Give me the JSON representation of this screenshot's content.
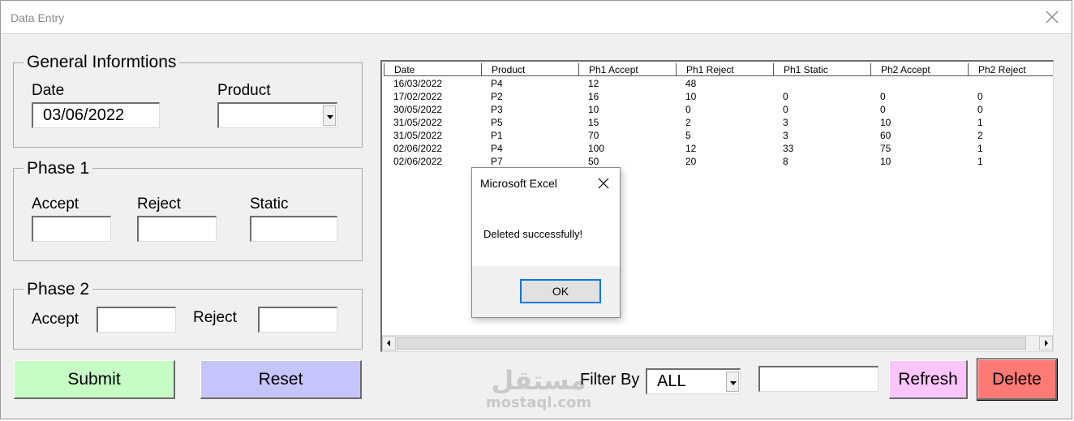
{
  "window": {
    "title": "Data Entry"
  },
  "general": {
    "legend": "General Informtions",
    "date_label": "Date",
    "date_value": "03/06/2022",
    "product_label": "Product",
    "product_value": ""
  },
  "phase1": {
    "legend": "Phase 1",
    "accept_label": "Accept",
    "reject_label": "Reject",
    "static_label": "Static",
    "accept_value": "",
    "reject_value": "",
    "static_value": ""
  },
  "phase2": {
    "legend": "Phase 2",
    "accept_label": "Accept",
    "reject_label": "Reject",
    "accept_value": "",
    "reject_value": ""
  },
  "buttons": {
    "submit": "Submit",
    "reset": "Reset",
    "refresh": "Refresh",
    "delete": "Delete"
  },
  "filter": {
    "label": "Filter By",
    "selected": "ALL",
    "search_value": ""
  },
  "table": {
    "columns": [
      "Date",
      "Product",
      "Ph1 Accept",
      "Ph1 Reject",
      "Ph1 Static",
      "Ph2 Accept",
      "Ph2 Reject"
    ],
    "rows": [
      [
        "16/03/2022",
        "P4",
        "12",
        "48",
        "",
        "",
        ""
      ],
      [
        "17/02/2022",
        "P2",
        "16",
        "10",
        "0",
        "0",
        "0"
      ],
      [
        "30/05/2022",
        "P3",
        "10",
        "0",
        "0",
        "0",
        "0"
      ],
      [
        "31/05/2022",
        "P5",
        "15",
        "2",
        "3",
        "10",
        "1"
      ],
      [
        "31/05/2022",
        "P1",
        "70",
        "5",
        "3",
        "60",
        "2"
      ],
      [
        "02/06/2022",
        "P4",
        "100",
        "12",
        "33",
        "75",
        "1"
      ],
      [
        "02/06/2022",
        "P7",
        "50",
        "20",
        "8",
        "10",
        "1"
      ]
    ]
  },
  "dialog": {
    "title": "Microsoft Excel",
    "message": "Deleted successfully!",
    "ok": "OK"
  },
  "watermark": {
    "arabic": "مستقل",
    "latin": "mostaql.com"
  },
  "colors": {
    "submit_bg": "#c5fdc5",
    "reset_bg": "#c5c5fc",
    "refresh_bg": "#fcc5fc",
    "delete_bg": "#ff7a74",
    "dialog_focus": "#0078d7"
  }
}
